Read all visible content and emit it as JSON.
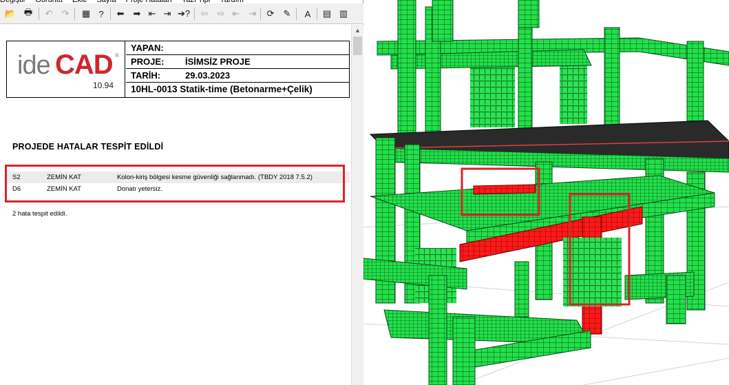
{
  "menu": {
    "items": [
      "Değiştir",
      "Görüntü",
      "Ekle",
      "Sayfa",
      "Proje Hataları",
      "Yazı Tipi",
      "Yardım"
    ]
  },
  "toolbar": {
    "buttons": [
      {
        "name": "open-icon",
        "glyph": "📂",
        "enabled": true
      },
      {
        "name": "print-icon",
        "glyph": "🖶",
        "enabled": true
      },
      {
        "name": "undo-icon",
        "glyph": "↶",
        "enabled": false
      },
      {
        "name": "redo-icon",
        "glyph": "↷",
        "enabled": false
      },
      {
        "name": "calculator-icon",
        "glyph": "▦",
        "enabled": true
      },
      {
        "name": "help-icon",
        "glyph": "?",
        "enabled": true
      },
      {
        "name": "arrow-left-icon",
        "glyph": "⬅",
        "enabled": true
      },
      {
        "name": "arrow-right-icon",
        "glyph": "➡",
        "enabled": true
      },
      {
        "name": "first-icon",
        "glyph": "⇤",
        "enabled": true
      },
      {
        "name": "last-icon",
        "glyph": "⇥",
        "enabled": true
      },
      {
        "name": "goto-icon",
        "glyph": "➔?",
        "enabled": true
      },
      {
        "name": "prev-disabled-icon",
        "glyph": "⇦",
        "enabled": false
      },
      {
        "name": "next-disabled-icon",
        "glyph": "⇨",
        "enabled": false
      },
      {
        "name": "first-disabled-icon",
        "glyph": "⇤",
        "enabled": false
      },
      {
        "name": "last-disabled-icon",
        "glyph": "⇥",
        "enabled": false
      },
      {
        "name": "refresh-icon",
        "glyph": "⟳",
        "enabled": true
      },
      {
        "name": "edit-icon",
        "glyph": "✎",
        "enabled": true
      },
      {
        "name": "font-icon",
        "glyph": "A",
        "enabled": true
      },
      {
        "name": "page-icon",
        "glyph": "▤",
        "enabled": true
      },
      {
        "name": "page-view-icon",
        "glyph": "▥",
        "enabled": true
      }
    ]
  },
  "report": {
    "logo": {
      "ide": "ide",
      "cad": "CAD",
      "reg": "®",
      "version": "10.94"
    },
    "yapan_label": "YAPAN:",
    "yapan_value": "",
    "proje_label": "PROJE:",
    "proje_value": "İSİMSİZ PROJE",
    "tarih_label": "TARİH:",
    "tarih_value": "29.03.2023",
    "title": "10HL-0013 Statik-time (Betonarme+Çelik)",
    "error_heading": "PROJEDE HATALAR TESPİT EDİLDİ",
    "errors": [
      {
        "code": "S2",
        "floor": "ZEMİN KAT",
        "message": "Kolon-kiriş bölgesi kesme güvenliği sağlanmadı. (TBDY 2018 7.5.2)"
      },
      {
        "code": "D6",
        "floor": "ZEMİN KAT",
        "message": "Donatı yetersiz."
      }
    ],
    "summary": "2 hata tespit edildi."
  },
  "colors": {
    "element_ok": "#22e04a",
    "element_error": "#ff1a1a",
    "highlight": "#d9242a",
    "logo_red": "#d0262b"
  }
}
